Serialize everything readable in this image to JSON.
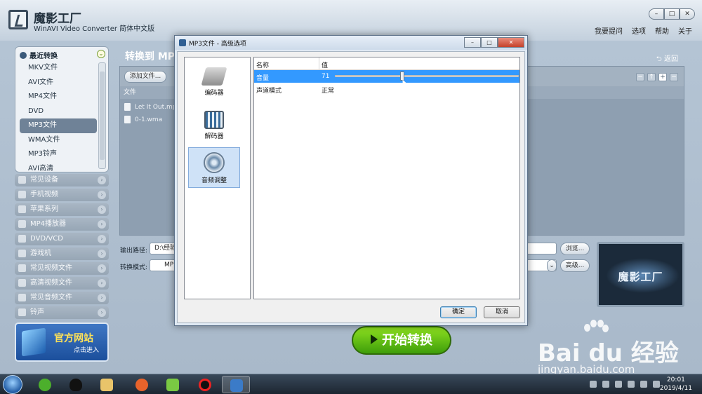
{
  "app": {
    "title": "魔影工厂",
    "subtitle": "WinAVI Video Converter 简体中文版",
    "menu": [
      "我要提问",
      "选项",
      "帮助",
      "关于"
    ]
  },
  "sidebar": {
    "recent_title": "最近转换",
    "recent_items": [
      {
        "label": "MKV文件",
        "selected": false
      },
      {
        "label": "AVI文件",
        "selected": false
      },
      {
        "label": "MP4文件",
        "selected": false
      },
      {
        "label": "DVD",
        "selected": false
      },
      {
        "label": "MP3文件",
        "selected": true
      },
      {
        "label": "WMA文件",
        "selected": false
      },
      {
        "label": "MP3铃声",
        "selected": false
      },
      {
        "label": "AVI高清",
        "selected": false
      }
    ],
    "categories": [
      "常见设备",
      "手机视频",
      "苹果系列",
      "MP4播放器",
      "DVD/VCD",
      "游戏机",
      "常见视频文件",
      "高清视频文件",
      "常见音频文件",
      "铃声"
    ],
    "banner": {
      "title": "官方网站",
      "subtitle": "点击进入"
    }
  },
  "main": {
    "title": "转换到 MP",
    "back": "返回",
    "add_file": "添加文件...",
    "file_column": "文件",
    "files": [
      "Let It Out.mp",
      "0-1.wma"
    ],
    "output_path_label": "输出路径:",
    "output_path_value": "D:\\经验",
    "mode_label": "转换模式:",
    "mode_value": "MP",
    "browse_button": "浏览...",
    "advanced_button": "高级...",
    "preview_logo": "魔影工厂",
    "start_button": "开始转换"
  },
  "dialog": {
    "title": "MP3文件 - 高级选项",
    "nav": [
      {
        "label": "编码器",
        "icon": "encoder-icon",
        "selected": false
      },
      {
        "label": "解码器",
        "icon": "decoder-icon",
        "selected": false
      },
      {
        "label": "音频调整",
        "icon": "audio-adjust-icon",
        "selected": true
      }
    ],
    "columns": {
      "name": "名称",
      "value": "值"
    },
    "rows": [
      {
        "name": "音量",
        "value": "71",
        "slider_fraction": 0.365,
        "selected": true
      },
      {
        "name": "声道模式",
        "value": "正常",
        "selected": false
      }
    ],
    "ok": "确定",
    "cancel": "取消"
  },
  "watermark": {
    "brand": "Bai du 经验",
    "url": "jingyan.baidu.com"
  },
  "taskbar": {
    "time": "20:01",
    "date": "2019/4/11"
  }
}
